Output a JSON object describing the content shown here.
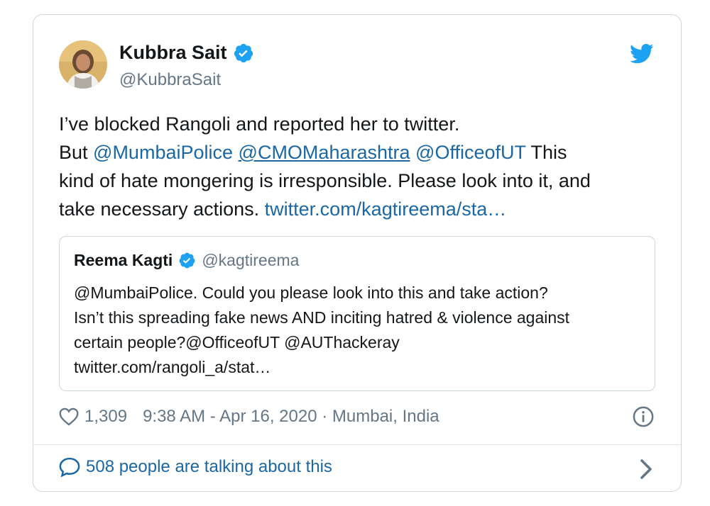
{
  "author": {
    "name": "Kubbra Sait",
    "handle": "@KubbraSait",
    "verified_icon": "verified-badge-icon"
  },
  "tweet": {
    "line1": "I’ve blocked Rangoli and reported her to twitter.",
    "but": "But ",
    "mention1": "@MumbaiPolice",
    "mention2": "@CMOMaharashtra",
    "mention3": "@OfficeofUT",
    "after_mentions": " This",
    "line3": "kind of hate mongering is irresponsible. Please look into it, and",
    "line4": "take necessary actions. ",
    "link": "twitter.com/kagtireema/sta…"
  },
  "quote": {
    "name": "Reema Kagti",
    "handle": "@kagtireema",
    "line1": "@MumbaiPolice. Could you please look into this and take action?",
    "line2": "Isn’t this spreading fake news AND inciting hatred & violence against",
    "line3": "certain people?@OfficeofUT @AUThackeray",
    "line4": "twitter.com/rangoli_a/stat…"
  },
  "meta": {
    "likes": "1,309",
    "timestamp": "9:38 AM - Apr 16, 2020 · Mumbai, India"
  },
  "footer": {
    "talking": "508 people are talking about this"
  },
  "colors": {
    "link_blue": "#1b67a4",
    "verified_blue": "#1da1f2",
    "text": "#14171a",
    "muted": "#657786",
    "border": "#d0d5da"
  },
  "icons": [
    "twitter-bird-icon",
    "verified-badge-icon",
    "heart-icon",
    "info-icon",
    "comment-bubble-icon",
    "chevron-right-icon"
  ]
}
